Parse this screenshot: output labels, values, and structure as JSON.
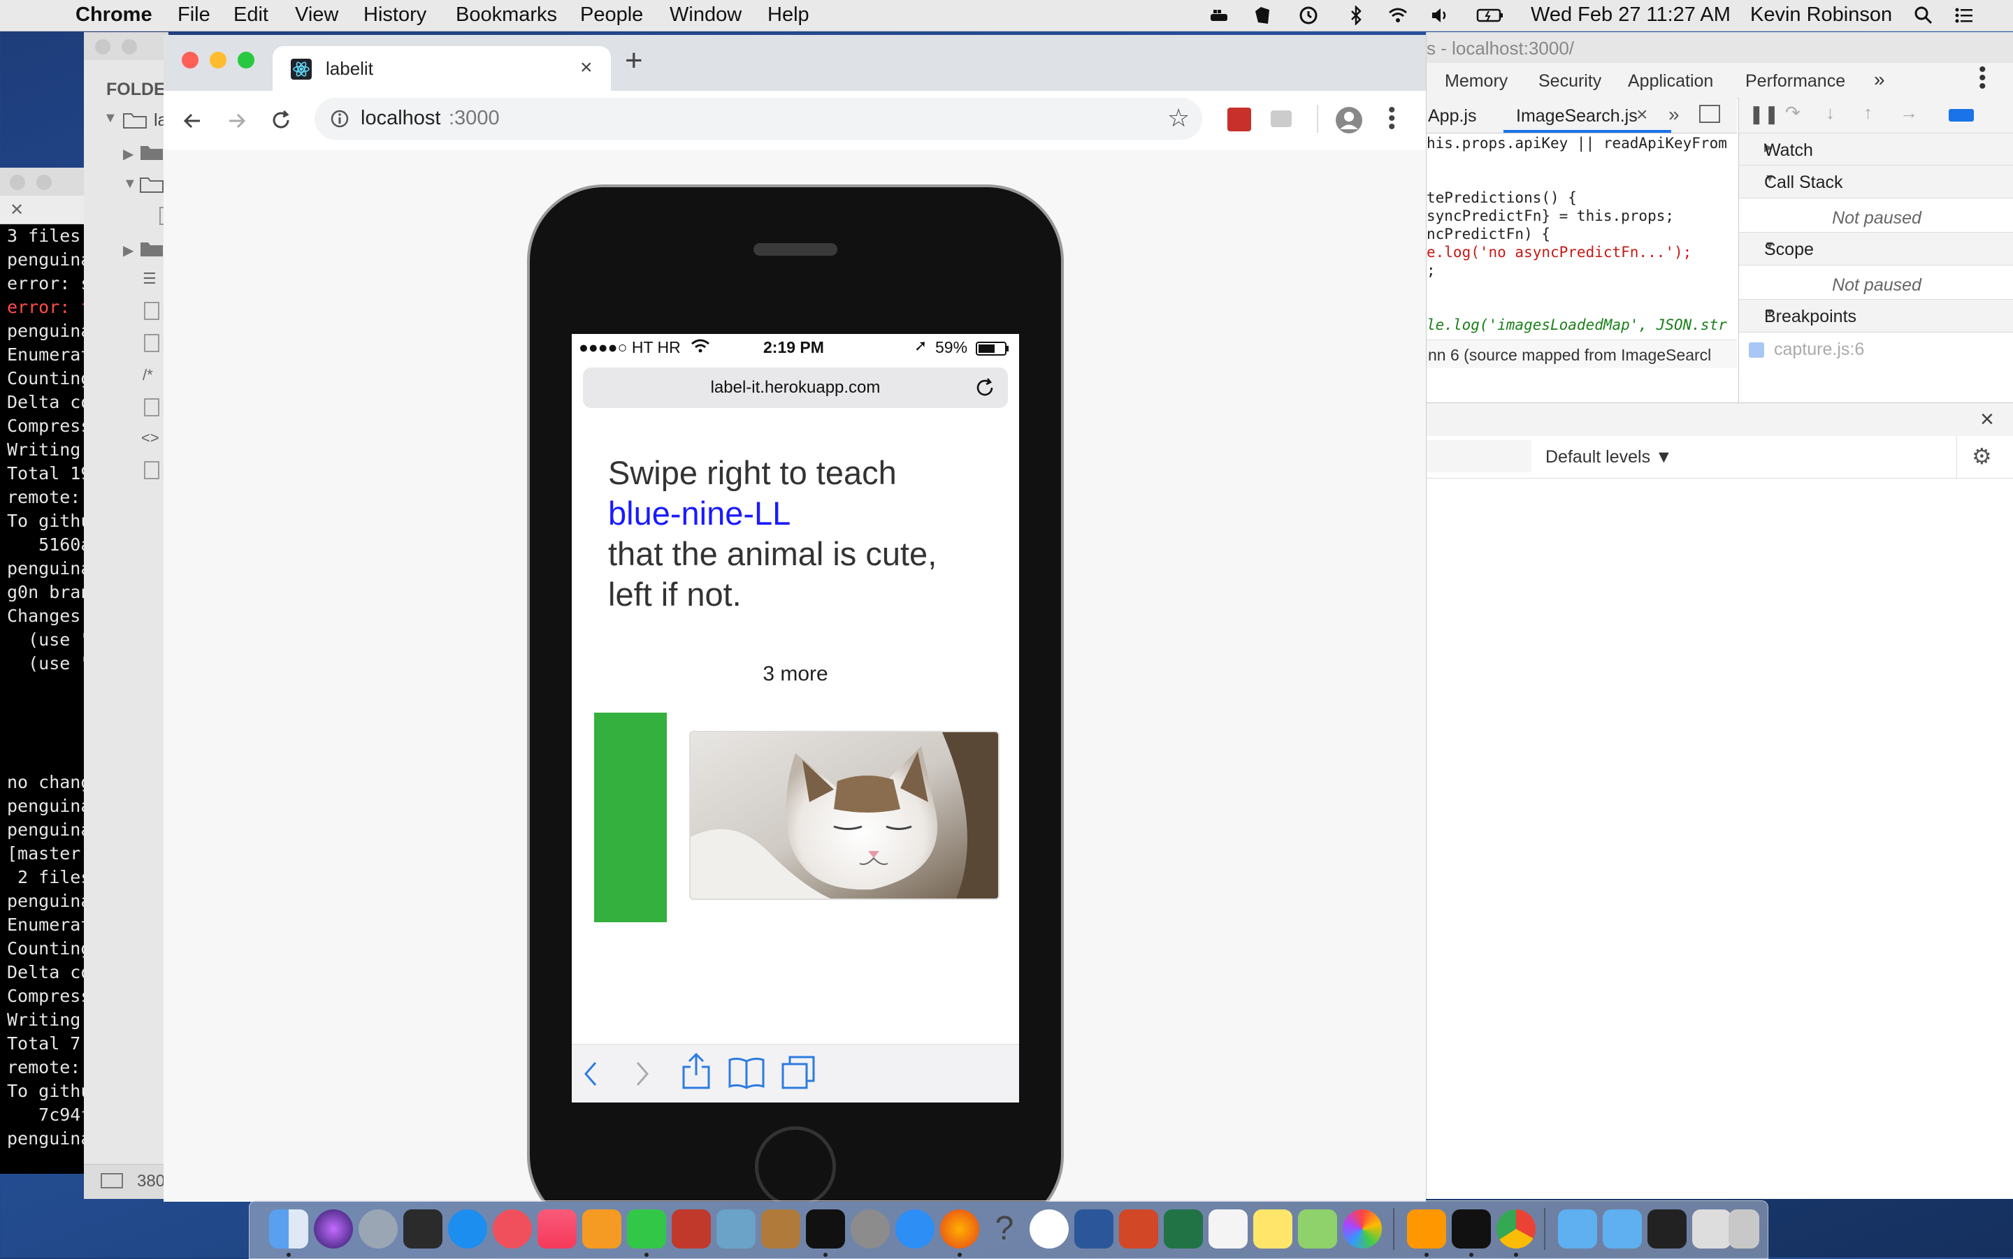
{
  "menubar": {
    "app_name": "Chrome",
    "items": [
      "File",
      "Edit",
      "View",
      "History",
      "Bookmarks",
      "People",
      "Window",
      "Help"
    ],
    "clock": "Wed Feb 27  11:27 AM",
    "user": "Kevin Robinson"
  },
  "terminal": {
    "lines": [
      {
        "text": "3 files",
        "err": false
      },
      {
        "text": "penguina",
        "err": false
      },
      {
        "text": "error: s",
        "err": false
      },
      {
        "text": "error: f",
        "err": true
      },
      {
        "text": "penguina",
        "err": false
      },
      {
        "text": "Enumerat",
        "err": false
      },
      {
        "text": "Counting",
        "err": false
      },
      {
        "text": "Delta co",
        "err": false
      },
      {
        "text": "Compress",
        "err": false
      },
      {
        "text": "Writing ",
        "err": false
      },
      {
        "text": "Total 19",
        "err": false
      },
      {
        "text": "remote: ",
        "err": false
      },
      {
        "text": "To githu",
        "err": false
      },
      {
        "text": "   5160a",
        "err": false
      },
      {
        "text": "penguina",
        "err": false
      },
      {
        "text": "g0n bran",
        "err": false
      },
      {
        "text": "Changes ",
        "err": false
      },
      {
        "text": "  (use \"",
        "err": false
      },
      {
        "text": "  (use \"",
        "err": false
      },
      {
        "text": "",
        "err": false
      },
      {
        "text": "",
        "err": false
      },
      {
        "text": "",
        "err": false
      },
      {
        "text": "",
        "err": false
      },
      {
        "text": "no chang",
        "err": false
      },
      {
        "text": "penguina",
        "err": false
      },
      {
        "text": "penguina",
        "err": false
      },
      {
        "text": "[master ",
        "err": false
      },
      {
        "text": " 2 files",
        "err": false
      },
      {
        "text": "penguina",
        "err": false
      },
      {
        "text": "Enumerat",
        "err": false
      },
      {
        "text": "Counting",
        "err": false
      },
      {
        "text": "Delta co",
        "err": false
      },
      {
        "text": "Compress",
        "err": false
      },
      {
        "text": "Writing ",
        "err": false
      },
      {
        "text": "Total 7 ",
        "err": false
      },
      {
        "text": "remote: ",
        "err": false
      },
      {
        "text": "To githu",
        "err": false
      },
      {
        "text": "   7c94f",
        "err": false
      },
      {
        "text": "penguina",
        "err": false
      }
    ]
  },
  "sidebar": {
    "title": "FOLDE",
    "folder_label": "la",
    "footer": "380"
  },
  "chrome": {
    "tab_title": "labelit",
    "url_host": "localhost",
    "url_port": ":3000"
  },
  "phone": {
    "carrier": "●●●●○ HT HR",
    "time": "2:19 PM",
    "battery": "59%",
    "url": "label-it.herokuapp.com",
    "headline_1": "Swipe right to teach",
    "agent_name": "blue-nine-LL",
    "headline_2": "that the animal is cute,",
    "headline_3": "left if not.",
    "remaining": "3 more"
  },
  "devtools": {
    "title": "s - localhost:3000/",
    "tabs": [
      "Memory",
      "Security",
      "Application",
      "Performance"
    ],
    "file_tabs": [
      "App.js",
      "ImageSearch.js"
    ],
    "code": [
      "his.props.apiKey || readApiKeyFrom",
      "",
      "",
      "tePredictions() {",
      "syncPredictFn} = this.props;",
      "ncPredictFn) {",
      "e.log('no asyncPredictFn...');",
      ";",
      "",
      "",
      "le.log('imagesLoadedMap', JSON.str"
    ],
    "source_info": "nn 6   (source mapped from ImageSearcl",
    "watch": "Watch",
    "call_stack": "Call Stack",
    "not_paused": "Not paused",
    "scope": "Scope",
    "not_paused_2": "Not paused",
    "breakpoints": "Breakpoints",
    "breakpoint_item": "capture.js:6",
    "levels": "Default levels ▼"
  },
  "colors": {
    "brand_blue": "#1a1aff",
    "swipe_green": "#33b03e"
  }
}
